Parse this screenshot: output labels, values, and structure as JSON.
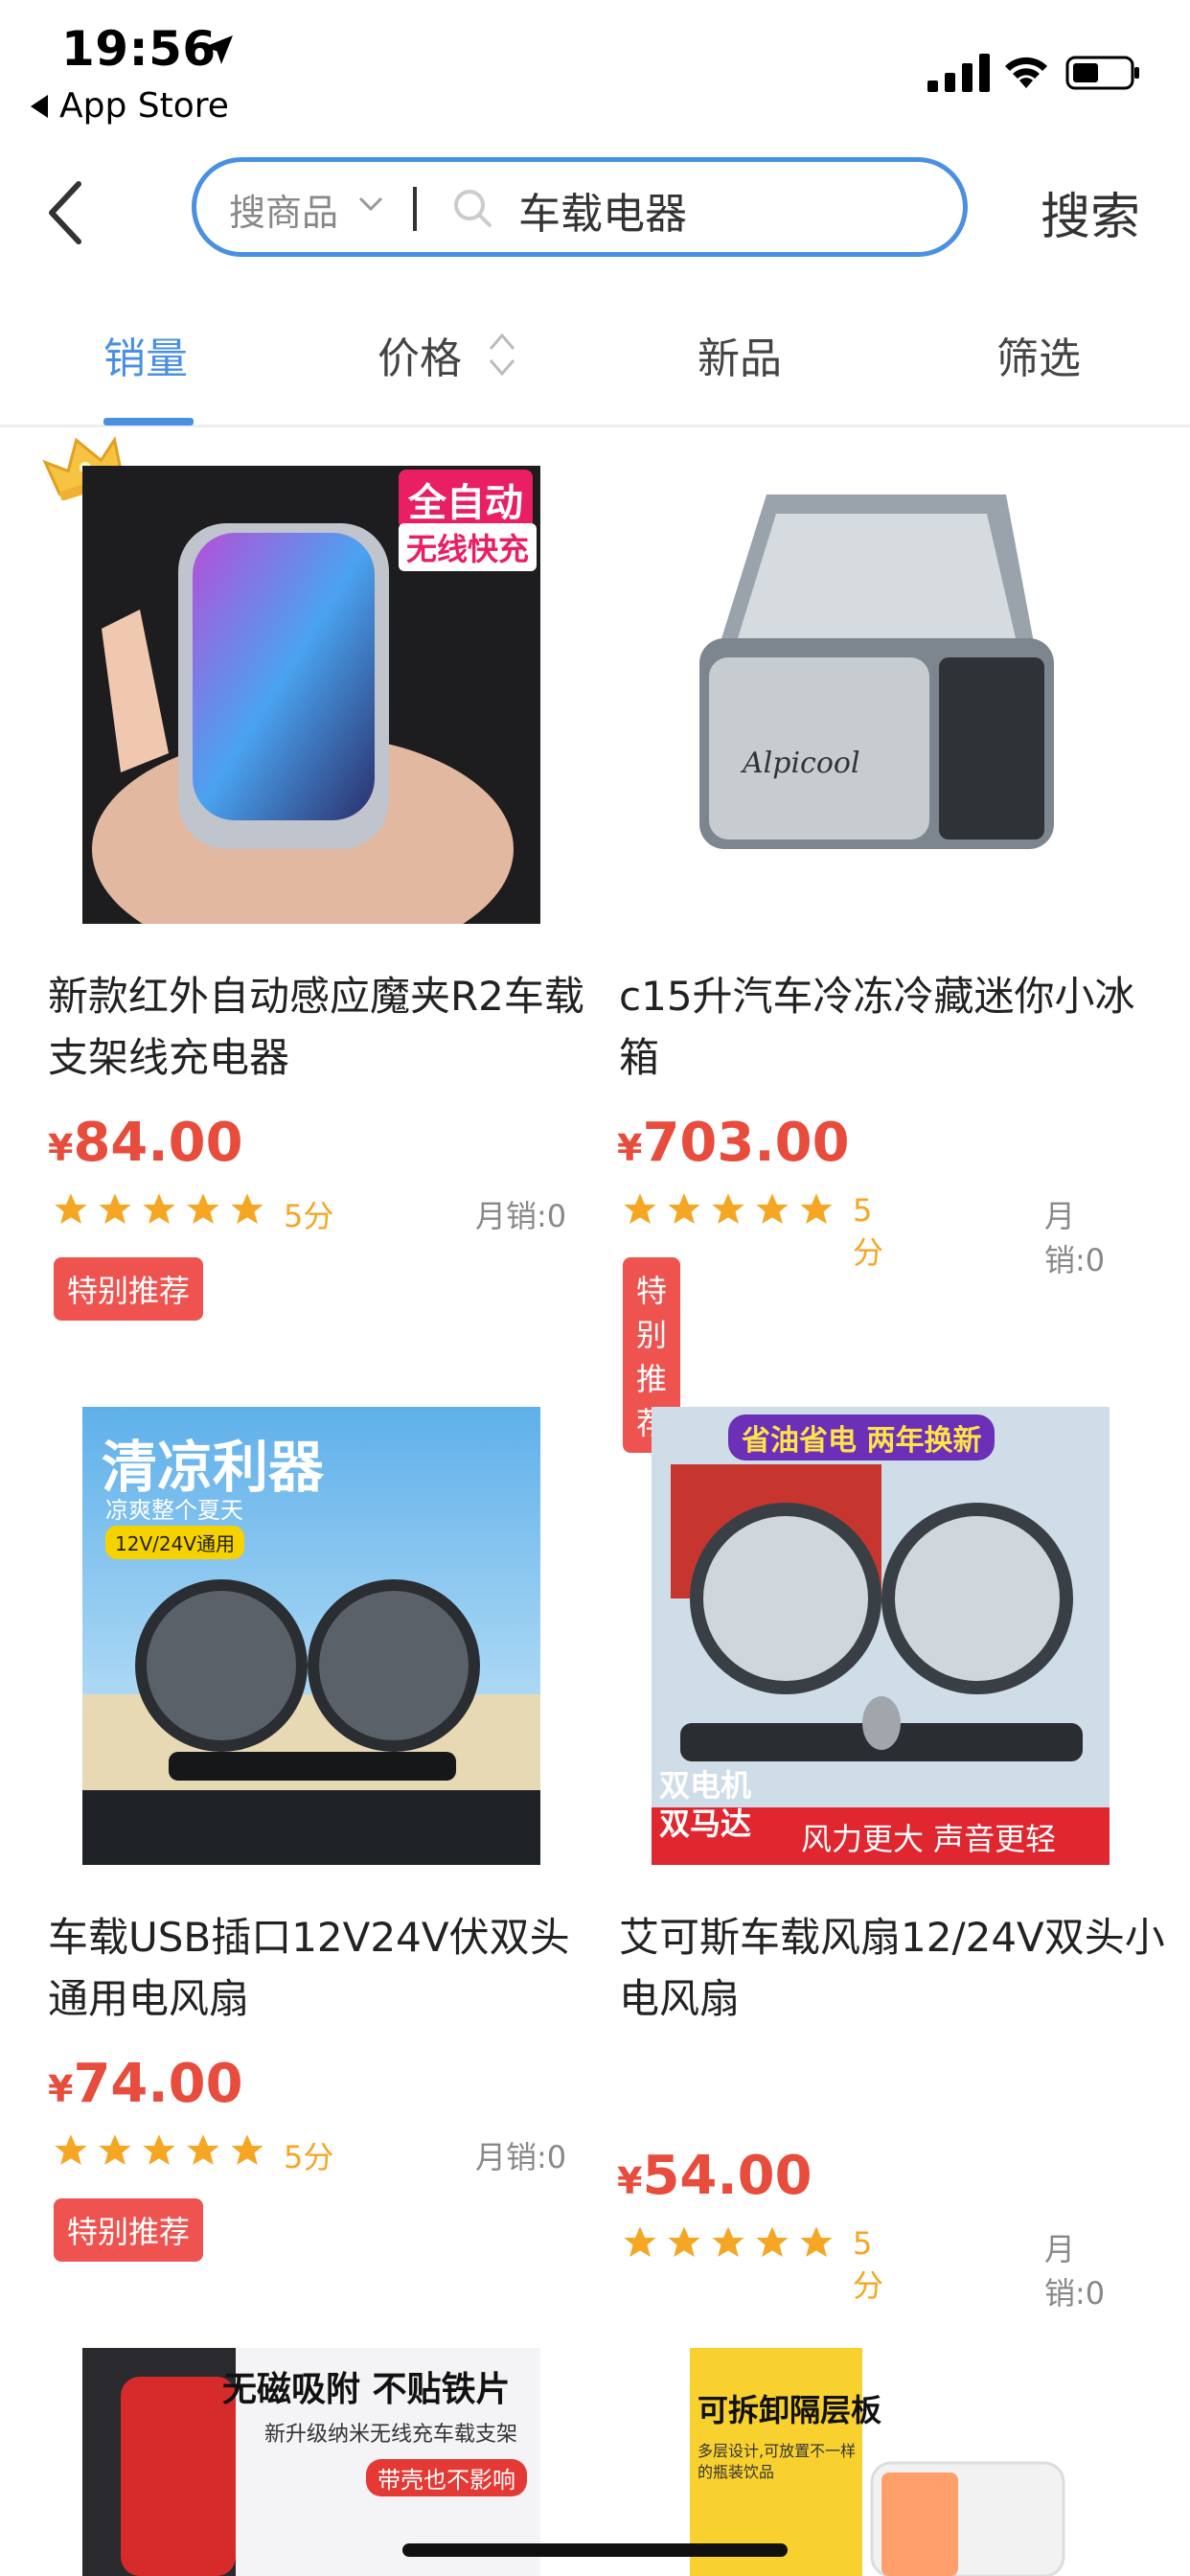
{
  "status_bar": {
    "time": "19:56",
    "back_app": "App Store"
  },
  "header": {
    "scope_label": "搜商品",
    "query": "车载电器",
    "search_button": "搜索"
  },
  "tabs": [
    {
      "label": "销量",
      "active": true
    },
    {
      "label": "价格",
      "active": false
    },
    {
      "label": "新品",
      "active": false
    },
    {
      "label": "筛选",
      "active": false
    }
  ],
  "products": [
    {
      "title": "新款红外自动感应魔夹R2车载支架线充电器",
      "price_symbol": "¥",
      "price": "84.00",
      "rating": 5,
      "score_label": "5分",
      "sales": "月销:0",
      "badge": "特别推荐",
      "img_text_1": "全自动",
      "img_text_2": "无线快充"
    },
    {
      "title": "c15升汽车冷冻冷藏迷你小冰箱",
      "price_symbol": "¥",
      "price": "703.00",
      "rating": 5,
      "score_label": "5分",
      "sales": "月销:0",
      "badge": "特别推荐",
      "img_brand": "Alpicool"
    },
    {
      "title": "车载USB插口12V24V伏双头通用电风扇",
      "price_symbol": "¥",
      "price": "74.00",
      "rating": 5,
      "score_label": "5分",
      "sales": "月销:0",
      "badge": "特别推荐",
      "img_text_1": "清凉利器",
      "img_text_2": "凉爽整个夏天",
      "img_text_3": "12V/24V通用"
    },
    {
      "title": "艾可斯车载风扇12/24V双头小电风扇",
      "price_symbol": "¥",
      "price": "54.00",
      "rating": 5,
      "score_label": "5分",
      "sales": "月销:0",
      "badge": "",
      "img_text_1": "省油省电 两年换新",
      "img_text_2": "双电机",
      "img_text_3": "双马达",
      "img_text_4": "风力更大 声音更轻"
    },
    {
      "img_text_1": "无磁吸附 不贴铁片",
      "img_text_2": "新升级纳米无线充车载支架",
      "img_text_3": "带壳也不影响"
    },
    {
      "img_text_1": "可拆卸隔层板",
      "img_text_2": "多层设计,可放置不一样",
      "img_text_3": "的瓶装饮品"
    }
  ],
  "colors": {
    "accent": "#4a90e2",
    "price": "#e84c3d",
    "star": "#f5a623",
    "badge": "#ef5350"
  }
}
